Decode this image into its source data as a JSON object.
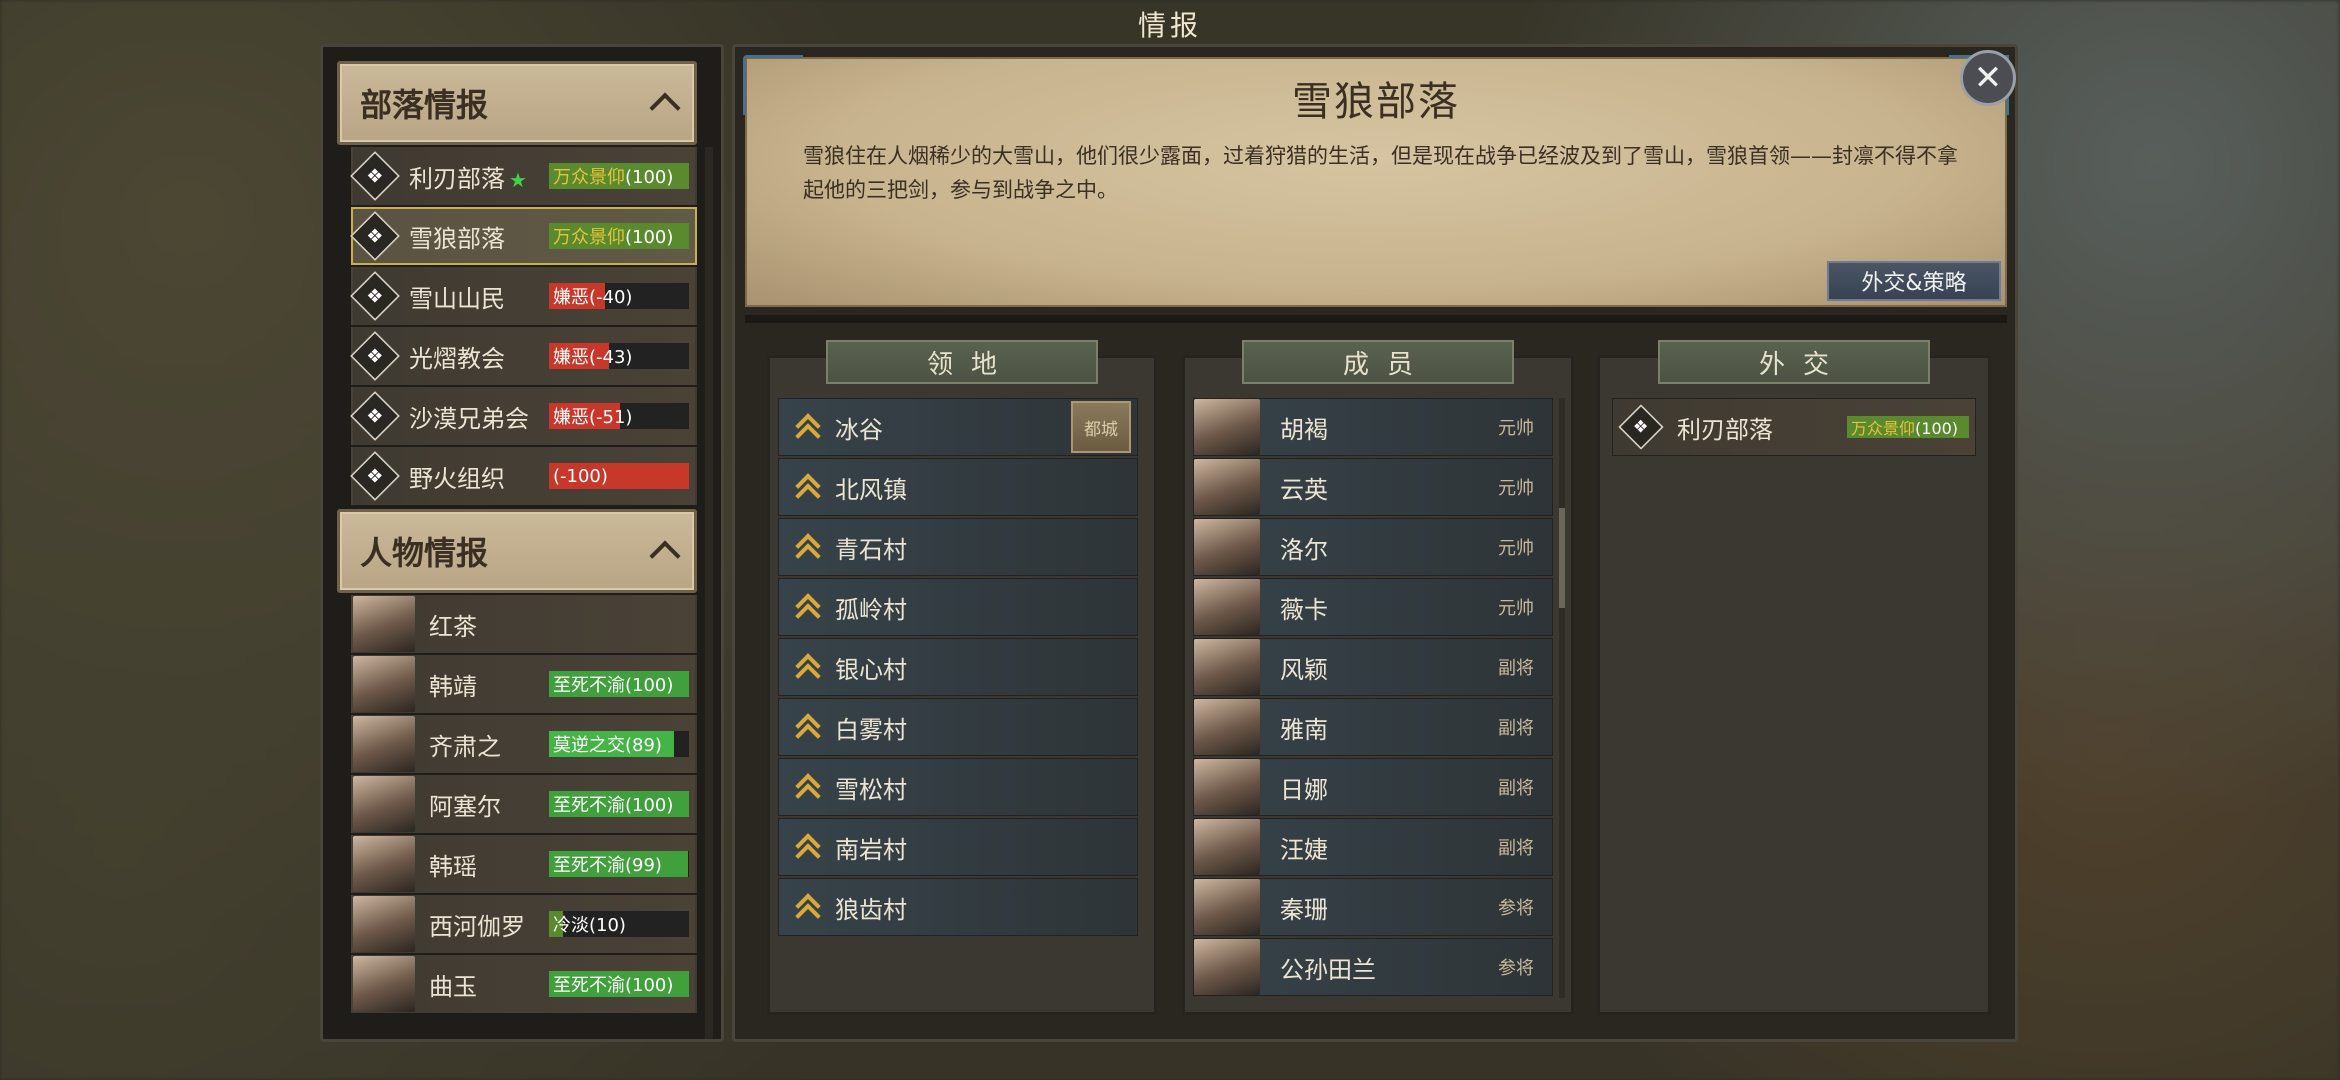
{
  "window_title": "情报",
  "colors": {
    "reverence": "#5a8a2e",
    "reverence_text": "#e8c23a",
    "hatred": "#c8382a",
    "loyal": "#3fa03c",
    "sworn": "#44b446",
    "cold": "#5a8a2e"
  },
  "left": {
    "tribe_section": {
      "title": "部落情报"
    },
    "tribes": [
      {
        "name": "利刃部落",
        "star": "★",
        "status": "万众景仰",
        "value": "(100)",
        "icon": "spiral-emblem-icon",
        "kind": "reverence",
        "level": 1.0
      },
      {
        "name": "雪狼部落",
        "star": "",
        "status": "万众景仰",
        "value": "(100)",
        "icon": "wolf-emblem-icon",
        "kind": "reverence",
        "level": 1.0,
        "selected": true
      },
      {
        "name": "雪山山民",
        "star": "",
        "status": "嫌恶",
        "value": "(-40)",
        "icon": "mountain-emblem-icon",
        "kind": "hatred",
        "level": 0.4
      },
      {
        "name": "光熠教会",
        "star": "",
        "status": "嫌恶",
        "value": "(-43)",
        "icon": "cross-emblem-icon",
        "kind": "hatred",
        "level": 0.43
      },
      {
        "name": "沙漠兄弟会",
        "star": "",
        "status": "嫌恶",
        "value": "(-51)",
        "icon": "crossed-swords-emblem-icon",
        "kind": "hatred",
        "level": 0.51
      },
      {
        "name": "野火组织",
        "star": "",
        "status": "",
        "value": "(-100)",
        "icon": "flame-emblem-icon",
        "kind": "hatred",
        "level": 1.0
      }
    ],
    "people_section": {
      "title": "人物情报"
    },
    "people": [
      {
        "name": "红茶",
        "status": "",
        "value": "",
        "kind": "none",
        "level": 0
      },
      {
        "name": "韩靖",
        "status": "至死不渝",
        "value": "(100)",
        "kind": "loyal",
        "level": 1.0
      },
      {
        "name": "齐肃之",
        "status": "莫逆之交",
        "value": "(89)",
        "kind": "sworn",
        "level": 0.89
      },
      {
        "name": "阿塞尔",
        "status": "至死不渝",
        "value": "(100)",
        "kind": "loyal",
        "level": 1.0
      },
      {
        "name": "韩瑶",
        "status": "至死不渝",
        "value": "(99)",
        "kind": "loyal",
        "level": 0.99
      },
      {
        "name": "西河伽罗",
        "status": "冷淡",
        "value": "(10)",
        "kind": "cold",
        "level": 0.1
      },
      {
        "name": "曲玉",
        "status": "至死不渝",
        "value": "(100)",
        "kind": "loyal",
        "level": 1.0
      }
    ]
  },
  "faction": {
    "title": "雪狼部落",
    "description": "雪狼住在人烟稀少的大雪山，他们很少露面，过着狩猎的生活，但是现在战争已经波及到了雪山，雪狼首领——封凛不得不拿起他的三把剑，参与到战争之中。",
    "diplomacy_button": "外交&策略",
    "close_symbol": "✕"
  },
  "territory": {
    "header": "领地",
    "capital_label": "都城",
    "items": [
      "冰谷",
      "北风镇",
      "青石村",
      "孤岭村",
      "银心村",
      "白雾村",
      "雪松村",
      "南岩村",
      "狼齿村"
    ]
  },
  "members": {
    "header": "成员",
    "items": [
      {
        "name": "胡褐",
        "rank": "元帅"
      },
      {
        "name": "云英",
        "rank": "元帅"
      },
      {
        "name": "洛尔",
        "rank": "元帅"
      },
      {
        "name": "薇卡",
        "rank": "元帅"
      },
      {
        "name": "风颖",
        "rank": "副将"
      },
      {
        "name": "雅南",
        "rank": "副将"
      },
      {
        "name": "日娜",
        "rank": "副将"
      },
      {
        "name": "汪婕",
        "rank": "副将"
      },
      {
        "name": "秦珊",
        "rank": "参将"
      },
      {
        "name": "公孙田兰",
        "rank": "参将"
      }
    ]
  },
  "diplomacy": {
    "header": "外交",
    "items": [
      {
        "name": "利刃部落",
        "status": "万众景仰",
        "value": "(100)",
        "icon": "spiral-emblem-icon"
      }
    ]
  }
}
